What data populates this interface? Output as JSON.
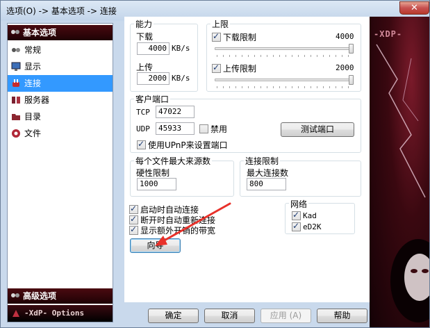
{
  "window": {
    "title": "选项(O) -> 基本选项 -> 连接",
    "close_glyph": "✕"
  },
  "sidebar": {
    "section_basic": "基本选项",
    "items": [
      {
        "label": "常规",
        "icon": "general-icon"
      },
      {
        "label": "显示",
        "icon": "monitor-icon"
      },
      {
        "label": "连接",
        "icon": "connection-icon",
        "selected": true
      },
      {
        "label": "服务器",
        "icon": "server-icon"
      },
      {
        "label": "目录",
        "icon": "folder-icon"
      },
      {
        "label": "文件",
        "icon": "file-icon"
      }
    ],
    "section_advanced": "高级选项",
    "footer": "-XdP- Options"
  },
  "capacity": {
    "title": "能力",
    "download_label": "下载",
    "download_value": "4000",
    "download_unit": "KB/s",
    "upload_label": "上传",
    "upload_value": "2000",
    "upload_unit": "KB/s"
  },
  "limits": {
    "title": "上限",
    "download_limit_label": "下载限制",
    "download_limit_checked": true,
    "download_limit_value": "4000",
    "download_limit_level": 1.0,
    "upload_limit_label": "上传限制",
    "upload_limit_checked": true,
    "upload_limit_value": "2000",
    "upload_limit_level": 1.0
  },
  "client_port": {
    "title": "客户端口",
    "tcp_label": "TCP",
    "tcp_value": "47022",
    "udp_label": "UDP",
    "udp_value": "45933",
    "disable_label": "禁用",
    "disable_checked": false,
    "test_button": "测试端口",
    "upnp_label": "使用UPnP来设置端口",
    "upnp_checked": true
  },
  "max_sources": {
    "title": "每个文件最大来源数",
    "hard_limit_label": "硬性限制",
    "hard_limit_value": "1000"
  },
  "conn_limit": {
    "title": "连接限制",
    "max_conn_label": "最大连接数",
    "max_conn_value": "800"
  },
  "options": {
    "autoconnect_label": "启动时自动连接",
    "autoconnect_checked": true,
    "reconnect_label": "断开时自动重新连接",
    "reconnect_checked": true,
    "overhead_label": "显示额外开销的带宽",
    "overhead_checked": true,
    "wizard_button": "向导"
  },
  "network": {
    "title": "网络",
    "kad_label": "Kad",
    "kad_checked": true,
    "ed2k_label": "eD2K",
    "ed2k_checked": true
  },
  "footer_buttons": {
    "ok": "确定",
    "cancel": "取消",
    "apply": "应用 (A)",
    "help": "帮助"
  },
  "art": {
    "brand": "-XDP-"
  },
  "colors": {
    "selection": "#3399ff",
    "nav_header": "#2a0408",
    "annotation_arrow": "#e8312a"
  }
}
